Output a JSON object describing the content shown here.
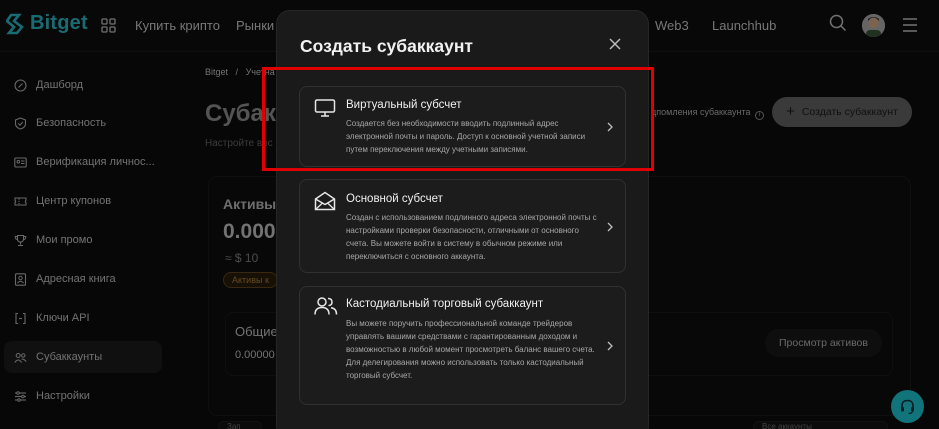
{
  "topbar": {
    "logo_text": "Bitget",
    "nav_items": [
      "Купить крипто",
      "Рынки",
      "Web3",
      "Launchhub"
    ],
    "icons": [
      "apps-grid-icon",
      "search-icon",
      "avatar",
      "menu-icon"
    ]
  },
  "sidebar": {
    "items": [
      {
        "label": "Дашборд",
        "icon": "dashboard-icon"
      },
      {
        "label": "Безопасность",
        "icon": "shield-icon"
      },
      {
        "label": "Верификация личнос...",
        "icon": "id-card-icon"
      },
      {
        "label": "Центр купонов",
        "icon": "coupon-icon"
      },
      {
        "label": "Мои промо",
        "icon": "trophy-icon"
      },
      {
        "label": "Адресная книга",
        "icon": "address-book-icon"
      },
      {
        "label": "Ключи API",
        "icon": "api-key-icon"
      },
      {
        "label": "Субаккаунты",
        "icon": "sub-accounts-icon",
        "active": true
      },
      {
        "label": "Настройки",
        "icon": "settings-icon"
      }
    ]
  },
  "main": {
    "breadcrumb_root": "Bitget",
    "breadcrumb_sep": "/",
    "breadcrumb_current": "Учетна",
    "page_title": "Субак",
    "page_sub": "Настройте вос",
    "restore_link": "дпомления субаккаунта",
    "create_button": "Создать субаккаунт",
    "assets_label": "Активы",
    "assets_value": "0.000",
    "assets_fiat": "≈ $ 10",
    "assets_badge": "Активы к",
    "total_label": "Общие",
    "total_value": "0.00000",
    "view_assets_button": "Просмотр активов",
    "bottom_left": "Зап",
    "bottom_right": "Все аккаунты"
  },
  "modal": {
    "title": "Создать субаккаунт",
    "options": [
      {
        "icon": "monitor-icon",
        "title": "Виртуальный субсчет",
        "description": "Создается без необходимости вводить подлинный адрес электронной почты и пароль. Доступ к основной учетной записи путем переключения между учетными записями."
      },
      {
        "icon": "envelope-icon",
        "title": "Основной субсчет",
        "description": "Создан с использованием подлинного адреса электронной почты с настройками проверки безопасности, отличными от основного счета. Вы можете войти в систему в обычном режиме или переключиться с основного аккаунта."
      },
      {
        "icon": "users-icon",
        "title": "Кастодиальный торговый субаккаунт",
        "description": "Вы можете поручить профессиональной команде трейдеров управлять вашими средствами с гарантированным доходом и возможностью в любой момент просмотреть баланс вашего счета. Для делегирования можно использовать только кастодиальный торговый субсчет."
      }
    ]
  },
  "colors": {
    "brand": "#2fc4d0",
    "highlight": "#e00000",
    "support": "#22d3e0"
  }
}
